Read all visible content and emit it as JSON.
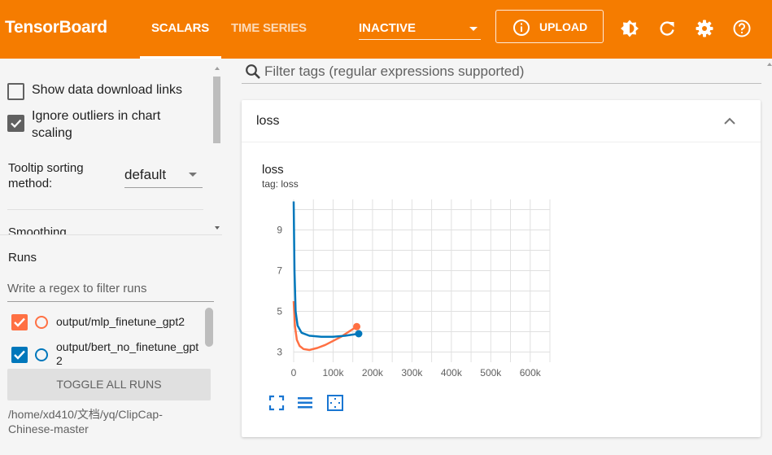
{
  "header": {
    "brand": "TensorBoard",
    "tabs": [
      {
        "label": "SCALARS",
        "active": true
      },
      {
        "label": "TIME SERIES",
        "active": false
      }
    ],
    "plugin_select": "INACTIVE",
    "upload_label": "UPLOAD",
    "icons": [
      "theme-toggle-icon",
      "reload-icon",
      "settings-icon",
      "help-icon"
    ],
    "accent_color": "#f57c00"
  },
  "sidebar": {
    "show_download_links": {
      "label": "Show data download links",
      "checked": false
    },
    "ignore_outliers": {
      "label": "Ignore outliers in chart scaling",
      "checked": true
    },
    "tooltip_sorting": {
      "label": "Tooltip sorting method:",
      "value": "default"
    },
    "smoothing_label": "Smoothing",
    "runs_title": "Runs",
    "runs_filter_placeholder": "Write a regex to filter runs",
    "runs": [
      {
        "name": "output/mlp_finetune_gpt2",
        "checked": true,
        "color": "#ff7043"
      },
      {
        "name": "output/bert_no_finetune_gpt2",
        "checked": true,
        "color": "#0077bb"
      }
    ],
    "toggle_all_label": "TOGGLE ALL RUNS",
    "run_path": "/home/xd410/文档/yq/ClipCap-Chinese-master"
  },
  "main": {
    "tag_filter_placeholder": "Filter tags (regular expressions supported)",
    "card_title": "loss",
    "chart_title": "loss",
    "chart_tag": "tag: loss"
  },
  "chart_data": {
    "type": "line",
    "title": "loss",
    "subtitle": "tag: loss",
    "xlabel": "",
    "ylabel": "",
    "xlim": [
      0,
      650000
    ],
    "ylim": [
      2.5,
      10.5
    ],
    "x_ticks": [
      0,
      100000,
      200000,
      300000,
      400000,
      500000,
      600000
    ],
    "x_tick_labels": [
      "0",
      "100k",
      "200k",
      "300k",
      "400k",
      "500k",
      "600k"
    ],
    "y_ticks": [
      3,
      5,
      7,
      9
    ],
    "y_tick_labels": [
      "3",
      "5",
      "7",
      "9"
    ],
    "grid": true,
    "series": [
      {
        "name": "output/mlp_finetune_gpt2",
        "color": "#ff7043",
        "x": [
          0,
          3000,
          8000,
          15000,
          25000,
          40000,
          60000,
          80000,
          100000,
          120000,
          140000,
          160000
        ],
        "y": [
          5.5,
          4.3,
          3.6,
          3.3,
          3.15,
          3.1,
          3.2,
          3.35,
          3.55,
          3.75,
          4.0,
          4.25
        ]
      },
      {
        "name": "output/bert_no_finetune_gpt2",
        "color": "#0077bb",
        "x": [
          0,
          2000,
          5000,
          10000,
          20000,
          40000,
          70000,
          100000,
          130000,
          165000
        ],
        "y": [
          10.4,
          7.0,
          5.0,
          4.3,
          3.95,
          3.8,
          3.75,
          3.75,
          3.8,
          3.9
        ]
      }
    ]
  }
}
